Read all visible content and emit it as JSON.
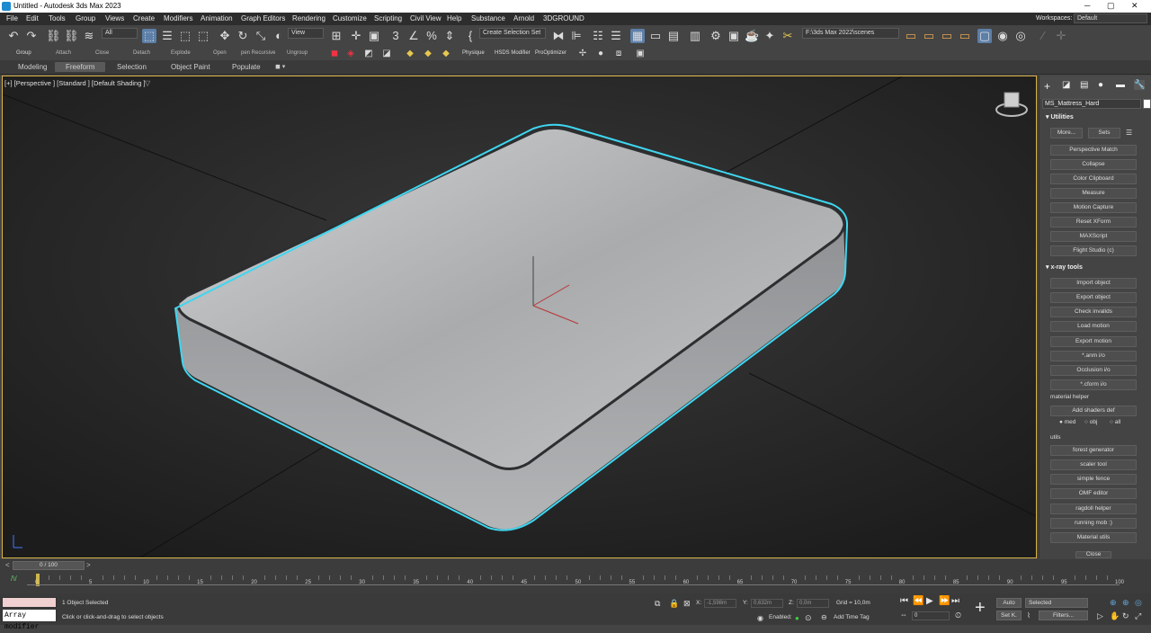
{
  "window": {
    "title": "Untitled - Autodesk 3ds Max 2023"
  },
  "menu": [
    "File",
    "Edit",
    "Tools",
    "Group",
    "Views",
    "Create",
    "Modifiers",
    "Animation",
    "Graph Editors",
    "Rendering",
    "Customize",
    "Scripting",
    "Civil View",
    "Help",
    "Substance",
    "Arnold",
    "3DGROUND"
  ],
  "workspace": {
    "label": "Workspaces:",
    "value": "Default"
  },
  "toolbar": {
    "selection_filter": "All",
    "ref_coord": "View",
    "selection_set": "Create Selection Set",
    "project_path": "F:\\3ds Max 2022\\scenes"
  },
  "toolbar2": {
    "items": [
      "Group",
      "Attach",
      "Close",
      "Detach",
      "Explode",
      "Open",
      "pen Recursive",
      "Ungroup"
    ],
    "plugins": [
      "Physique",
      "HSDS Modifier",
      "ProOptimizer"
    ]
  },
  "ribbon": {
    "tabs": [
      "Modeling",
      "Freeform",
      "Selection",
      "Object Paint",
      "Populate"
    ],
    "active": "Freeform"
  },
  "viewport": {
    "label": "[+] [Perspective ] [Standard ] [Default Shading ]"
  },
  "command_panel": {
    "object_name": "MS_Mattress_Hard",
    "utilities_title": "Utilities",
    "more": "More...",
    "sets": "Sets",
    "utilities": [
      "Perspective Match",
      "Collapse",
      "Color Clipboard",
      "Measure",
      "Motion Capture",
      "Reset XForm",
      "MAXScript",
      "Flight Studio (c)"
    ],
    "xray_title": "x-ray tools",
    "xray": [
      "Import object",
      "Export object",
      "Check invalids",
      "Load motion",
      "Export motion",
      "*.anm i/o",
      "Occlusion i/o",
      "*.cform i/o"
    ],
    "material_helper": "material helper",
    "add_shaders": "Add shaders def",
    "radios": [
      "med",
      "obj",
      "all"
    ],
    "utils_title": "utils",
    "utils": [
      "forest generator",
      "scaler tool",
      "simple fence",
      "OMF editor",
      "ragdoll helper",
      "running mob :)",
      "Material utils"
    ],
    "close": "Close"
  },
  "timeline": {
    "frame": "0 / 100",
    "ticks": [
      "0",
      "5",
      "10",
      "15",
      "20",
      "25",
      "30",
      "35",
      "40",
      "45",
      "50",
      "55",
      "60",
      "65",
      "70",
      "75",
      "80",
      "85",
      "90",
      "95",
      "100"
    ]
  },
  "status": {
    "listener": "Array modifier",
    "objects_selected": "1 Object Selected",
    "prompt": "Click or click-and-drag to select objects",
    "x_label": "X:",
    "x_value": "-1,598m",
    "y_label": "Y:",
    "y_value": "0,632m",
    "z_label": "Z:",
    "z_value": "0,0m",
    "grid": "Grid = 10,0m",
    "enabled": "Enabled:",
    "add_time_tag": "Add Time Tag",
    "auto": "Auto",
    "set_k": "Set K.",
    "selected": "Selected",
    "filters": "Filters...",
    "frame_field": "0"
  }
}
